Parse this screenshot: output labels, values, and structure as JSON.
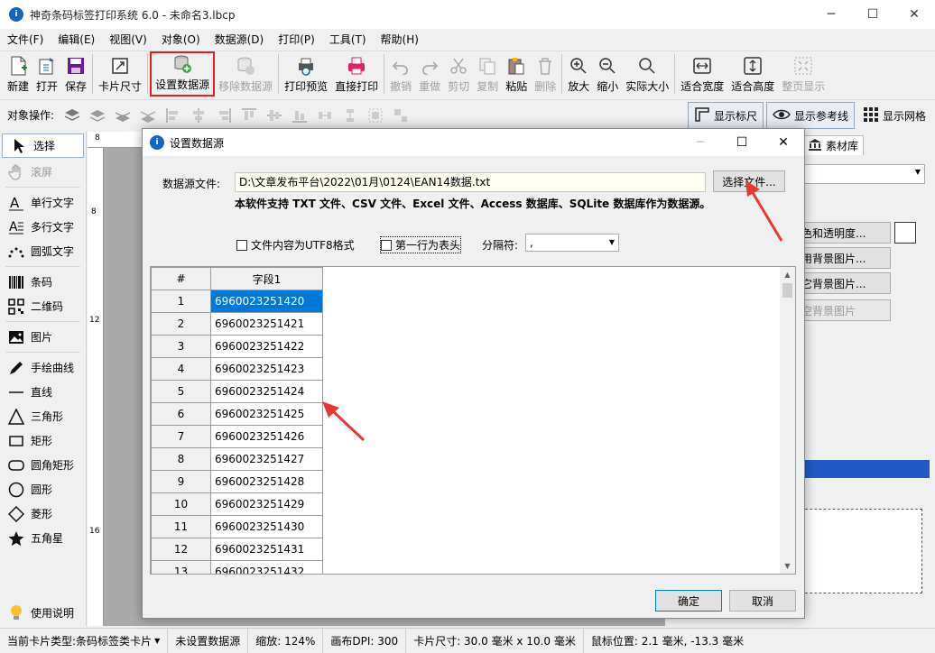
{
  "window": {
    "title": "神奇条码标签打印系统 6.0 - 未命名3.lbcp",
    "icon_text": "i"
  },
  "menu": [
    "文件(F)",
    "编辑(E)",
    "视图(V)",
    "对象(O)",
    "数据源(D)",
    "打印(P)",
    "工具(T)",
    "帮助(H)"
  ],
  "toolbar": {
    "new": "新建",
    "open": "打开",
    "save": "保存",
    "card_size": "卡片尺寸",
    "set_datasource": "设置数据源",
    "remove_datasource": "移除数据源",
    "print_preview": "打印预览",
    "direct_print": "直接打印",
    "undo": "撤销",
    "redo": "重做",
    "cut": "剪切",
    "copy": "复制",
    "paste": "粘贴",
    "delete": "删除",
    "zoom_in": "放大",
    "zoom_out": "缩小",
    "actual_size": "实际大小",
    "fit_width": "适合宽度",
    "fit_height": "适合高度",
    "fit_page": "整页显示"
  },
  "opsbar": {
    "label": "对象操作:",
    "show_ruler": "显示标尺",
    "show_guides": "显示参考线",
    "show_grid": "显示网格"
  },
  "tools": {
    "select": "选择",
    "pan": "滚屏",
    "single_text": "单行文字",
    "multi_text": "多行文字",
    "arc_text": "圆弧文字",
    "barcode": "条码",
    "qrcode": "二维码",
    "image": "图片",
    "freehand": "手绘曲线",
    "line": "直线",
    "triangle": "三角形",
    "rectangle": "矩形",
    "rounded_rect": "圆角矩形",
    "circle": "圆形",
    "diamond": "菱形",
    "star": "五角星",
    "help": "使用说明"
  },
  "ruler": {
    "t8": "8",
    "l8": "8",
    "l12": "12",
    "l16": "16"
  },
  "right_panel": {
    "tab": "素材库",
    "btn_color": "色和透明度...",
    "btn_bg1": "用背景图片...",
    "btn_bg2": "它背景图片...",
    "btn_bg3": "空背景图片"
  },
  "statusbar": {
    "card_type_label": "当前卡片类型:",
    "card_type": "条码标签类卡片",
    "datasource": "未设置数据源",
    "zoom": "缩放: 124%",
    "dpi": "画布DPI: 300",
    "card_size": "卡片尺寸: 30.0 毫米 x 10.0 毫米",
    "mouse_pos": "鼠标位置: 2.1 毫米, -13.3 毫米"
  },
  "dialog": {
    "title": "设置数据源",
    "file_label": "数据源文件:",
    "file_path": "D:\\文章发布平台\\2022\\01月\\0124\\EAN14数据.txt",
    "choose_file": "选择文件...",
    "info": "本软件支持 TXT 文件、CSV 文件、Excel 文件、Access 数据库、SQLite 数据库作为数据源。",
    "utf8": "文件内容为UTF8格式",
    "first_row_header": "第一行为表头",
    "sep_label": "分隔符:",
    "sep_value": ",",
    "grid_header_num": "#",
    "grid_header_field": "字段1",
    "rows": [
      {
        "n": "1",
        "v": "6960023251420"
      },
      {
        "n": "2",
        "v": "6960023251421"
      },
      {
        "n": "3",
        "v": "6960023251422"
      },
      {
        "n": "4",
        "v": "6960023251423"
      },
      {
        "n": "5",
        "v": "6960023251424"
      },
      {
        "n": "6",
        "v": "6960023251425"
      },
      {
        "n": "7",
        "v": "6960023251426"
      },
      {
        "n": "8",
        "v": "6960023251427"
      },
      {
        "n": "9",
        "v": "6960023251428"
      },
      {
        "n": "10",
        "v": "6960023251429"
      },
      {
        "n": "11",
        "v": "6960023251430"
      },
      {
        "n": "12",
        "v": "6960023251431"
      },
      {
        "n": "13",
        "v": "6960023251432"
      }
    ],
    "ok": "确定",
    "cancel": "取消"
  },
  "colors": {
    "accent": "#0078d7",
    "highlight_red": "#e02020",
    "annotation_arrow": "#e53935"
  }
}
